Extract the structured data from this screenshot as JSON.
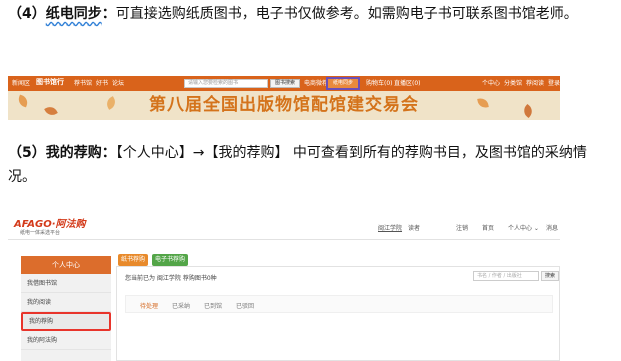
{
  "section4": {
    "number": "（4）",
    "heading": "纸电同步",
    "colon": "：",
    "text": "可直接选购纸质图书，电子书仅做参考。如需购电子书可联系图书馆老师。"
  },
  "screenshot1": {
    "nav": {
      "logo": "图书馆行",
      "items": [
        "新闻区",
        "荐书馆",
        "好书",
        "论坛"
      ],
      "search_placeholder": "请输入您要检索的图书",
      "search_button": "图书搜索",
      "mid_items": [
        "电商微荐"
      ],
      "highlight_tab": "纸电同步",
      "right_items": [
        "购物车(0)",
        "直播区(0)",
        "个中心",
        "分类馆",
        "荐阅读",
        "登录"
      ]
    },
    "banner_title": "第八届全国出版物馆配馆建交易会"
  },
  "section5": {
    "number": "（5）",
    "heading": "我的荐购",
    "colon": "：",
    "text": "【个人中心】→【我的荐购】 中可查看到所有的荐购书目，及图书馆的采纳情况。"
  },
  "screenshot2": {
    "logo": "AFAGO·阿法购",
    "logo_sub": "纸电一体采选平台",
    "top_items": [
      "闽江学院",
      "读者",
      "注销",
      "首页",
      "个人中心 ⌄",
      "消息"
    ],
    "sidebar": {
      "header": "个人中心",
      "items": [
        "我借图书馆",
        "我的阅读",
        "我的荐购",
        "我的阿法购"
      ]
    },
    "tabs": {
      "paper": "纸书荐购",
      "ebook": "电子书荐购"
    },
    "summary": "您当前已为 闽江学院 荐购图书0种",
    "search_placeholder": "书名 / 作者 / 出版社",
    "search_button": "搜索",
    "filters": [
      "待处理",
      "已采纳",
      "已到馆",
      "已驳回"
    ],
    "colors": {
      "accent": "#dc6d2c",
      "paper_tab": "#e88a2b",
      "ebook_tab": "#53a548",
      "highlight_border": "#e8342b"
    }
  }
}
